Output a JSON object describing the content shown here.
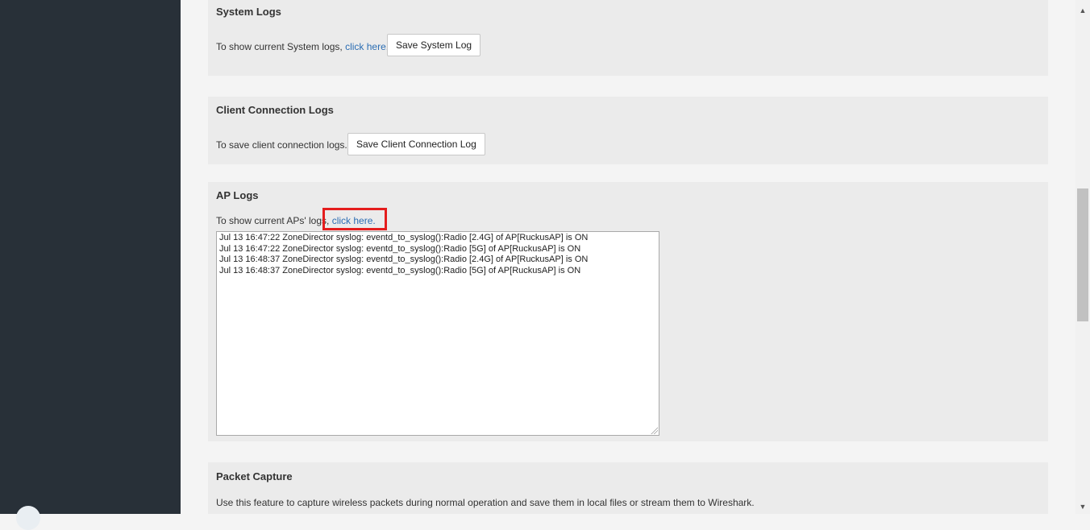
{
  "sections": {
    "system_logs": {
      "title": "System Logs",
      "desc": "To show current System logs,",
      "link": "click here.",
      "button": "Save System Log"
    },
    "client_logs": {
      "title": "Client Connection Logs",
      "desc": "To save client connection logs.",
      "button": "Save Client Connection Log"
    },
    "ap_logs": {
      "title": "AP Logs",
      "desc": "To show current APs' logs,",
      "link": "click here.",
      "log_lines": [
        "Jul 13 16:47:22 ZoneDirector syslog: eventd_to_syslog():Radio [2.4G] of AP[RuckusAP] is ON",
        "Jul 13 16:47:22 ZoneDirector syslog: eventd_to_syslog():Radio [5G] of AP[RuckusAP] is ON",
        "Jul 13 16:48:37 ZoneDirector syslog: eventd_to_syslog():Radio [2.4G] of AP[RuckusAP] is ON",
        "Jul 13 16:48:37 ZoneDirector syslog: eventd_to_syslog():Radio [5G] of AP[RuckusAP] is ON"
      ]
    },
    "packet_capture": {
      "title": "Packet Capture",
      "desc": "Use this feature to capture wireless packets during normal operation and save them in local files or stream them to Wireshark."
    }
  },
  "scrollbar": {
    "up_icon": "▲",
    "down_icon": "▼"
  },
  "colors": {
    "sidebar": "#283038",
    "panel": "#ebebeb",
    "link": "#2b6db3",
    "highlight": "#e41d1d"
  }
}
